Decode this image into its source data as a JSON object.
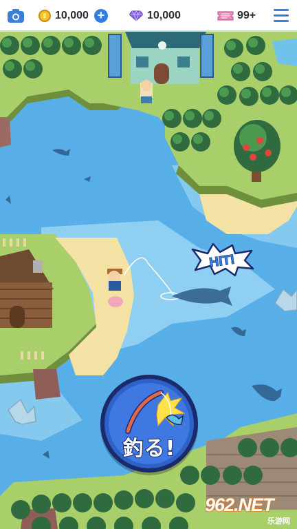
{
  "topbar": {
    "coins": "10,000",
    "gems": "10,000",
    "tickets": "99+"
  },
  "game": {
    "hit_text": "HIT!",
    "catch_button_label": "釣る!"
  },
  "watermark": {
    "main": "962.NET",
    "sub": "乐游网"
  },
  "icons": {
    "camera": "camera-icon",
    "coin": "coin-icon",
    "add": "plus-icon",
    "gem": "gem-icon",
    "ticket": "ticket-icon",
    "menu": "hamburger-menu-icon",
    "rod": "fishing-rod-icon"
  },
  "colors": {
    "sea": "#5ab0e6",
    "shallow": "#8fd0f2",
    "grass": "#a9cf6a",
    "sand": "#f4e2a4",
    "button": "#2d62c8",
    "accent": "#2e7ee6"
  }
}
